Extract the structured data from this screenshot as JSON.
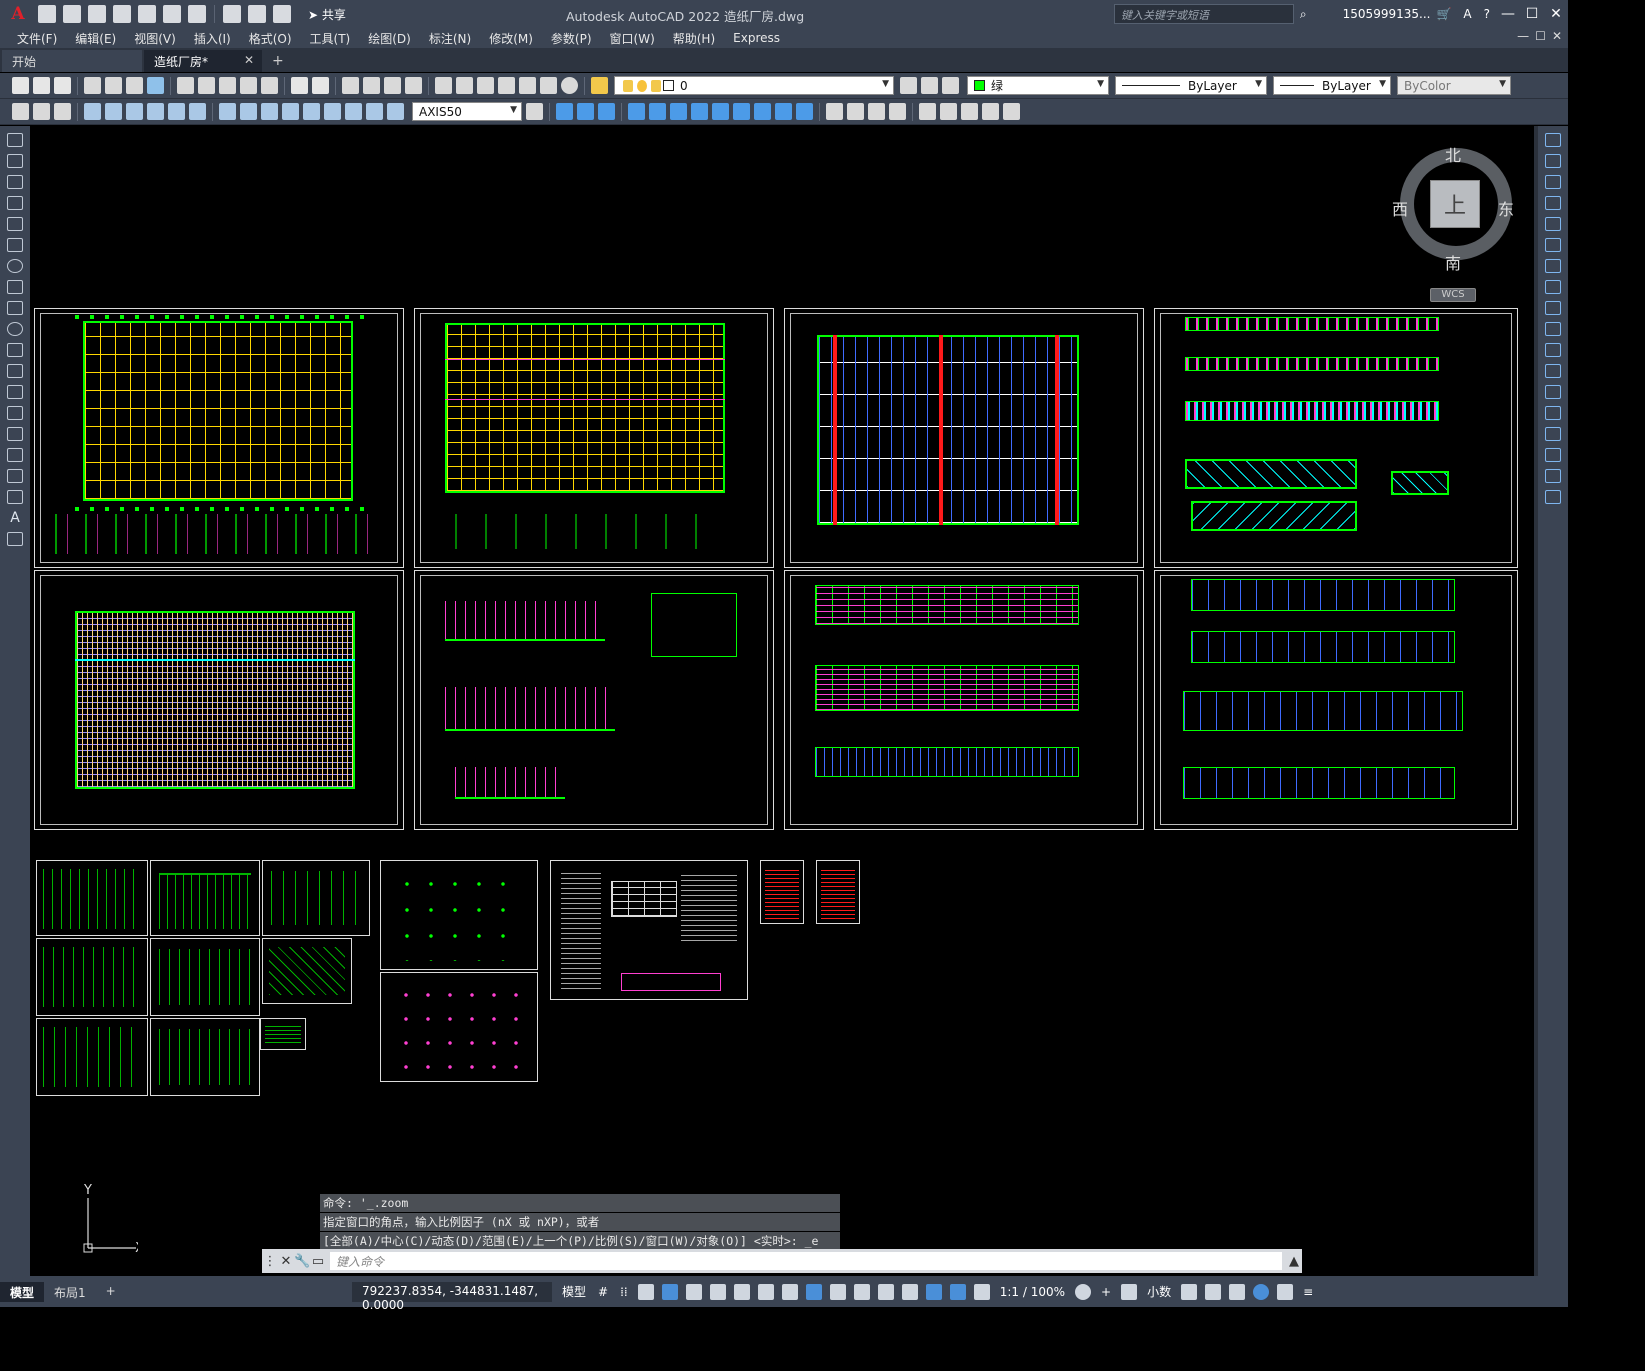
{
  "title_bar": {
    "logo": "A",
    "share_label": "共享",
    "app_title": "Autodesk AutoCAD 2022    造纸厂房.dwg",
    "search_placeholder": "键入关键字或短语",
    "user": "1505999135...",
    "min": "—",
    "max": "☐",
    "close": "✕",
    "help": "?"
  },
  "menu": {
    "items": [
      "文件(F)",
      "编辑(E)",
      "视图(V)",
      "插入(I)",
      "格式(O)",
      "工具(T)",
      "绘图(D)",
      "标注(N)",
      "修改(M)",
      "参数(P)",
      "窗口(W)",
      "帮助(H)",
      "Express"
    ]
  },
  "doc_tabs": {
    "tabs": [
      {
        "label": "开始"
      },
      {
        "label": "造纸厂房*"
      }
    ],
    "close": "✕",
    "add": "+"
  },
  "toolbar": {
    "layer_value": "0",
    "color_value": "绿",
    "linetype_value": "ByLayer",
    "lineweight_value": "ByLayer",
    "plotstyle_value": "ByColor",
    "dimstyle_value": "AXIS50",
    "color_swatch": "#00ff00"
  },
  "viewcube": {
    "north": "北",
    "south": "南",
    "west": "西",
    "east": "东",
    "top": "上",
    "wcs": "WCS"
  },
  "ucs": {
    "x": "X",
    "y": "Y"
  },
  "command": {
    "history": [
      "命令: '_.zoom",
      "指定窗口的角点，输入比例因子 (nX 或 nXP)，或者",
      "[全部(A)/中心(C)/动态(D)/范围(E)/上一个(P)/比例(S)/窗口(W)/对象(O)] <实时>: _e"
    ],
    "placeholder": "键入命令"
  },
  "status": {
    "layout_tabs": [
      "模型",
      "布局1"
    ],
    "add": "+",
    "coords": "792237.8354, -344831.1487, 0.0000",
    "model": "模型",
    "scale": "1:1 / 100%",
    "units": "小数"
  }
}
